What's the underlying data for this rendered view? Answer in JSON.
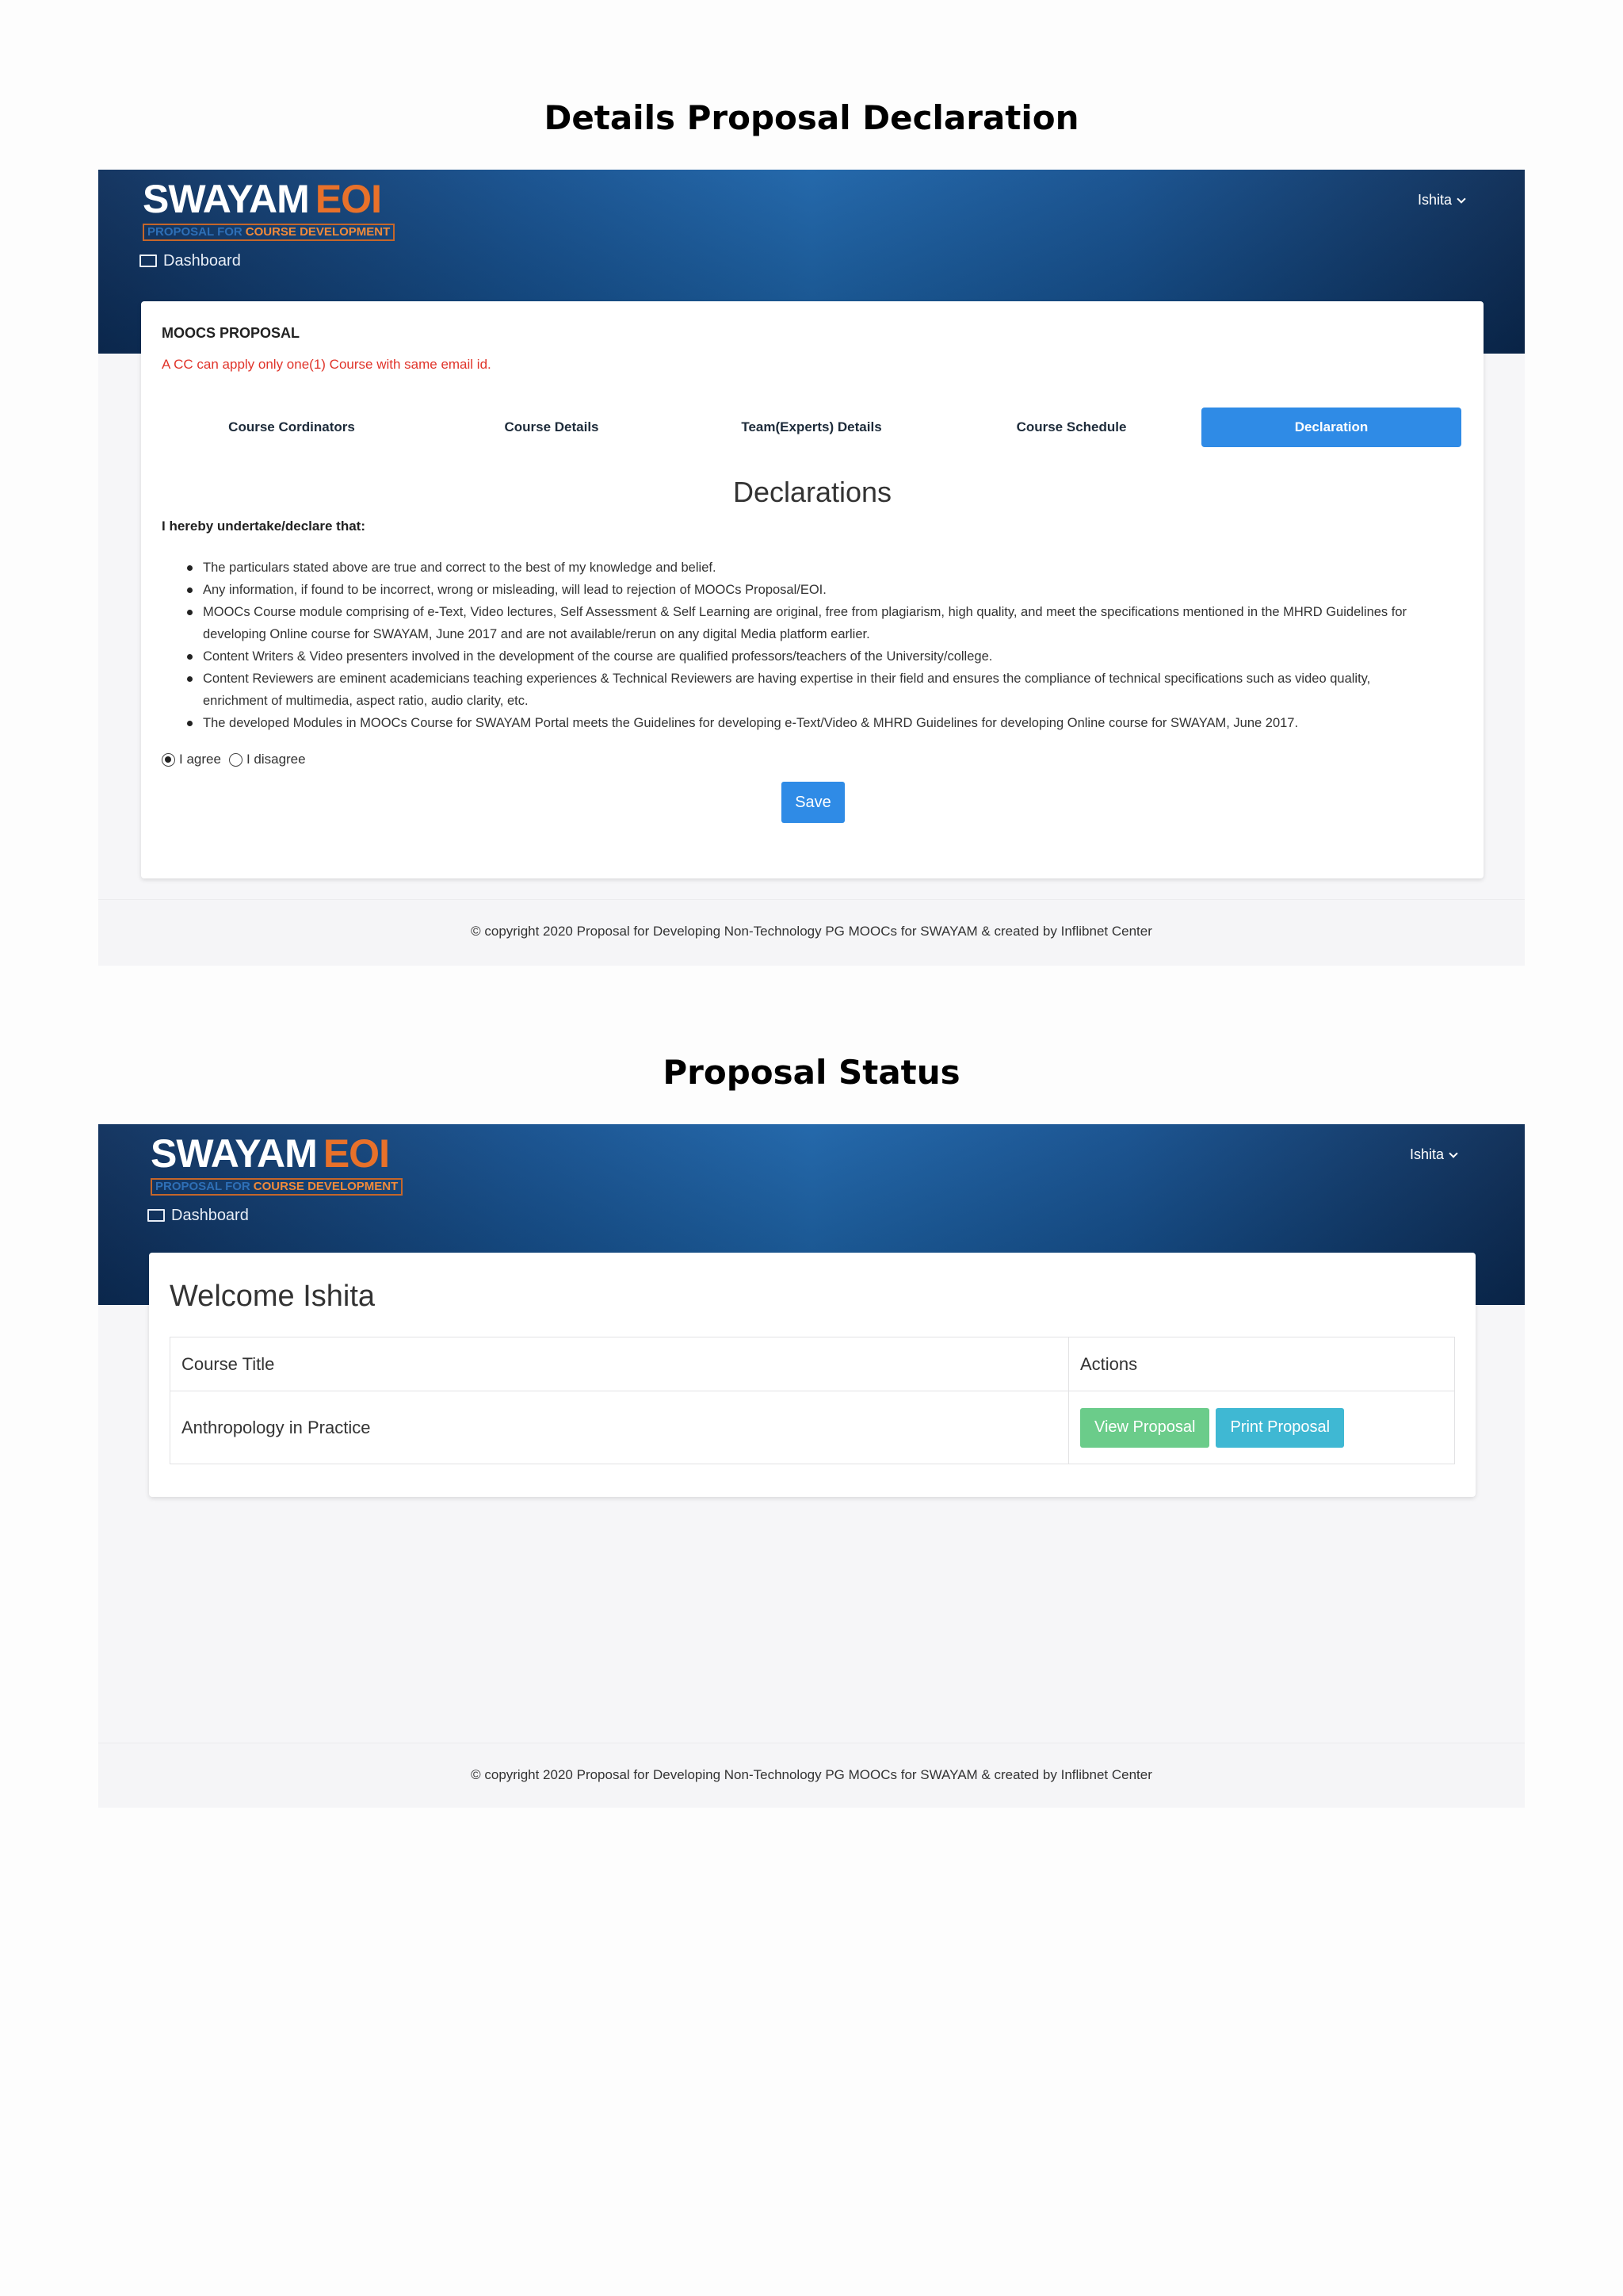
{
  "section1": {
    "heading": "Details Proposal Declaration",
    "header": {
      "logo_main": "SWAYAM",
      "logo_accent": "EOI",
      "logo_sub_a": "PROPOSAL FOR",
      "logo_sub_b": "COURSE DEVELOPMENT",
      "user": "Ishita",
      "nav_dashboard": "Dashboard"
    },
    "card": {
      "title": "MOOCS PROPOSAL",
      "note": "A CC can apply only one(1) Course with same email id.",
      "tabs": [
        {
          "label": "Course Cordinators"
        },
        {
          "label": "Course Details"
        },
        {
          "label": "Team(Experts) Details"
        },
        {
          "label": "Course Schedule"
        },
        {
          "label": "Declaration"
        }
      ],
      "active_tab": "Declaration",
      "decl_title": "Declarations",
      "decl_sub": "I hereby undertake/declare that:",
      "items": [
        "The particulars stated above are true and correct to the best of my knowledge and belief.",
        "Any information, if found to be incorrect, wrong or misleading, will lead to rejection of MOOCs Proposal/EOI.",
        "MOOCs Course module comprising of e-Text, Video lectures, Self Assessment & Self Learning are original, free from plagiarism, high quality, and meet the specifications mentioned in the MHRD Guidelines for developing Online course for SWAYAM, June 2017 and are not available/rerun on any digital Media platform earlier.",
        "Content Writers & Video presenters involved in the development of the course are qualified professors/teachers of the University/college.",
        "Content Reviewers are eminent academicians teaching experiences & Technical Reviewers are having expertise in their field and ensures the compliance of technical specifications such as video quality, enrichment of multimedia, aspect ratio, audio clarity, etc.",
        "The developed Modules in MOOCs Course for SWAYAM Portal meets the Guidelines for developing e-Text/Video & MHRD Guidelines for developing Online course for SWAYAM, June 2017."
      ],
      "agree_label": "I agree",
      "disagree_label": "I disagree",
      "selected": "I agree",
      "save_label": "Save"
    },
    "footer": "© copyright 2020 Proposal for Developing Non-Technology PG MOOCs for SWAYAM & created by Inflibnet Center"
  },
  "section2": {
    "heading": "Proposal Status",
    "header": {
      "logo_main": "SWAYAM",
      "logo_accent": "EOI",
      "logo_sub_a": "PROPOSAL FOR",
      "logo_sub_b": "COURSE DEVELOPMENT",
      "user": "Ishita",
      "nav_dashboard": "Dashboard"
    },
    "welcome": "Welcome Ishita",
    "table": {
      "columns": [
        "Course Title",
        "Actions"
      ],
      "rows": [
        {
          "course_title": "Anthropology in Practice",
          "view_label": "View Proposal",
          "print_label": "Print Proposal"
        }
      ]
    },
    "footer": "© copyright 2020 Proposal for Developing Non-Technology PG MOOCs for SWAYAM & created by Inflibnet Center"
  },
  "colors": {
    "header_blue": "#144f8e",
    "accent_orange": "#e8712a",
    "primary_blue": "#2f8be6",
    "note_red": "#e0342a",
    "view_green": "#5bc77e",
    "print_cyan": "#3fb8d3"
  },
  "icons": {
    "dashboard": "monitor-icon",
    "user_menu": "chevron-down-icon"
  }
}
